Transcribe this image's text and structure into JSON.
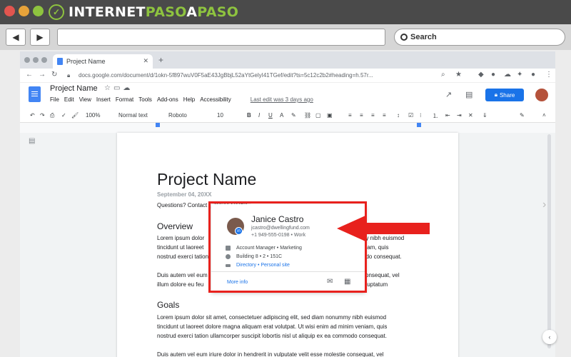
{
  "site": {
    "logo_mark": "✓",
    "logo_part1": "INTERNET",
    "logo_part2": "PASO",
    "logo_part3": "A",
    "logo_part4": "PASO",
    "search_label": "Search"
  },
  "browser": {
    "tab_title": "Project Name",
    "address": "docs.google.com/document/d/1okn-5f897wuV0F5aE43JgBbjL52aYtGelyI41TGef/edit?ts=5c12c2b2#heading=h.57r..."
  },
  "docs": {
    "title": "Project Name",
    "menu": [
      "File",
      "Edit",
      "View",
      "Insert",
      "Format",
      "Tools",
      "Add-ons",
      "Help",
      "Accessibility"
    ],
    "last_edit": "Last edit was 3 days ago",
    "share_label": "Share",
    "toolbar": {
      "zoom": "100%",
      "style": "Normal text",
      "font": "Roboto",
      "size": "10"
    }
  },
  "document": {
    "title": "Project Name",
    "date": "September 04, 20XX",
    "questions_prefix": "Questions? Contact",
    "contact_chip": "Janice Castro",
    "overview_heading": "Overview",
    "overview_left": [
      "Lorem ipsum dolor",
      "tincidunt ut laoreet",
      "nostrud exerci tation",
      "",
      "Duis autem vel eum",
      "illum dolore eu feu"
    ],
    "overview_right": [
      "uy nibh euismod",
      "niam, quis",
      "odo consequat.",
      "",
      "consequat, vel",
      "t luptatum"
    ],
    "goals_heading": "Goals",
    "goals_lines": [
      "Lorem ipsum dolor sit amet, consectetuer adipiscing elit, sed diam nonummy nibh euismod",
      "tincidunt ut laoreet dolore magna aliquam erat volutpat. Ut wisi enim ad minim veniam, quis",
      "nostrud exerci tation ullamcorper suscipit lobortis nisl ut aliquip ex ea commodo consequat.",
      "",
      "Duis autem vel eum iriure dolor in hendrerit in vulputate velit esse molestie consequat, vel"
    ]
  },
  "profile_card": {
    "avatar_badge": "in",
    "name": "Janice Castro",
    "email": "jcastro@dwellingfund.com",
    "phone": "+1 949-555-0198 • Work",
    "role": "Account Manager • Marketing",
    "location": "Building 8 • 2 • 151C",
    "link_directory": "Directory",
    "link_separator": "•",
    "link_site": "Personal site",
    "more_info": "More info"
  },
  "colors": {
    "annotation_red": "#e8211d",
    "share_blue": "#1a73e8",
    "logo_green": "#8ec33f"
  }
}
